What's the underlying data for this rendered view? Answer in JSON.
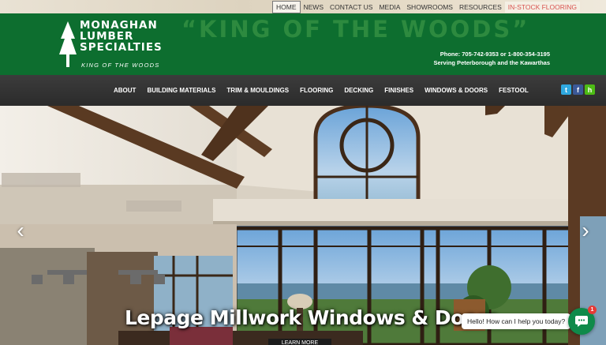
{
  "top_links": [
    {
      "label": "HOME",
      "active": true
    },
    {
      "label": "NEWS"
    },
    {
      "label": "CONTACT US"
    },
    {
      "label": "MEDIA"
    },
    {
      "label": "SHOWROOMS"
    },
    {
      "label": "RESOURCES"
    },
    {
      "label": "IN-STOCK FLOORING",
      "highlight": "#d9534f"
    }
  ],
  "header": {
    "logo_line1": "MONAGHAN",
    "logo_line2": "LUMBER",
    "logo_line3": "SPECIALTIES",
    "logo_tagline": "KING OF THE WOODS",
    "slogan": "“KING OF THE WOODS”",
    "phone": "Phone: 705-742-9353 or 1-800-354-3195",
    "service_area": "Serving Peterborough and the Kawarthas",
    "brand_green": "#0d6e2f"
  },
  "nav": {
    "items": [
      "ABOUT",
      "BUILDING MATERIALS",
      "TRIM & MOULDINGS",
      "FLOORING",
      "DECKING",
      "FINISHES",
      "WINDOWS & DOORS",
      "FESTOOL"
    ],
    "social": [
      {
        "icon": "twitter-icon",
        "glyph": "t"
      },
      {
        "icon": "facebook-icon",
        "glyph": "f"
      },
      {
        "icon": "houzz-icon",
        "glyph": "h"
      }
    ]
  },
  "hero": {
    "caption": "Lepage Millwork Windows & Doors",
    "button": "LEARN MORE",
    "prev_glyph": "‹",
    "next_glyph": "›"
  },
  "chat": {
    "greeting": "Hello! How can I help you today?",
    "badge": "1"
  }
}
